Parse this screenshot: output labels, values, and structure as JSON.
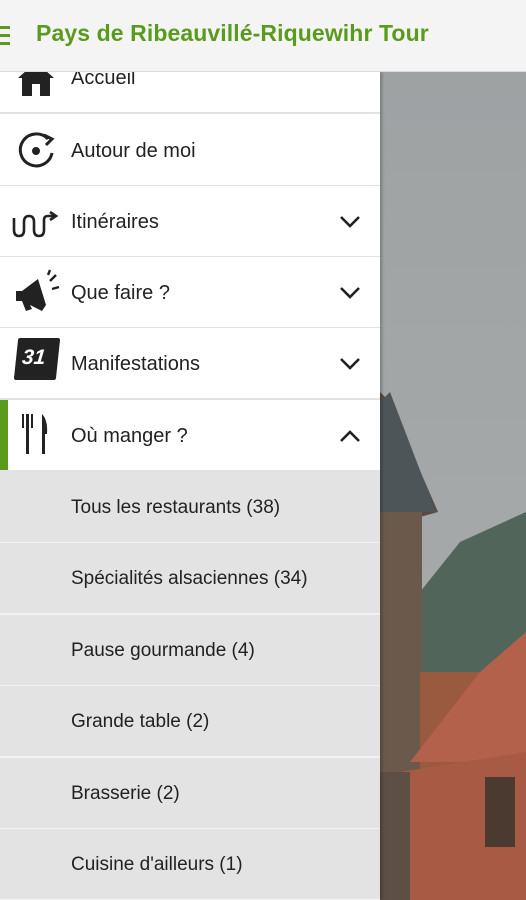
{
  "header": {
    "title": "Pays de Ribeauvillé-Riquewihr Tour"
  },
  "menu": {
    "items": [
      {
        "label": "Accueil",
        "icon": "home-icon"
      },
      {
        "label": "Autour de moi",
        "icon": "location-target-icon"
      },
      {
        "label": "Itinéraires",
        "icon": "route-icon",
        "chevron": "chevron-down-icon"
      },
      {
        "label": "Que faire ?",
        "icon": "megaphone-icon",
        "chevron": "chevron-down-icon"
      },
      {
        "label": "Manifestations",
        "icon": "calendar-icon",
        "calendar_number": "31",
        "chevron": "chevron-down-icon"
      },
      {
        "label": "Où manger ?",
        "icon": "fork-knife-icon",
        "chevron": "chevron-up-icon",
        "active": true
      }
    ],
    "subitems": [
      {
        "label": "Tous les restaurants (38)"
      },
      {
        "label": "Spécialités alsaciennes (34)"
      },
      {
        "label": "Pause gourmande (4)"
      },
      {
        "label": "Grande table (2)"
      },
      {
        "label": "Brasserie (2)"
      },
      {
        "label": "Cuisine d'ailleurs (1)"
      }
    ]
  },
  "colors": {
    "accent": "#5a9a1c",
    "submenu_bg": "#e3e3e3",
    "divider": "#e2e2e2"
  }
}
